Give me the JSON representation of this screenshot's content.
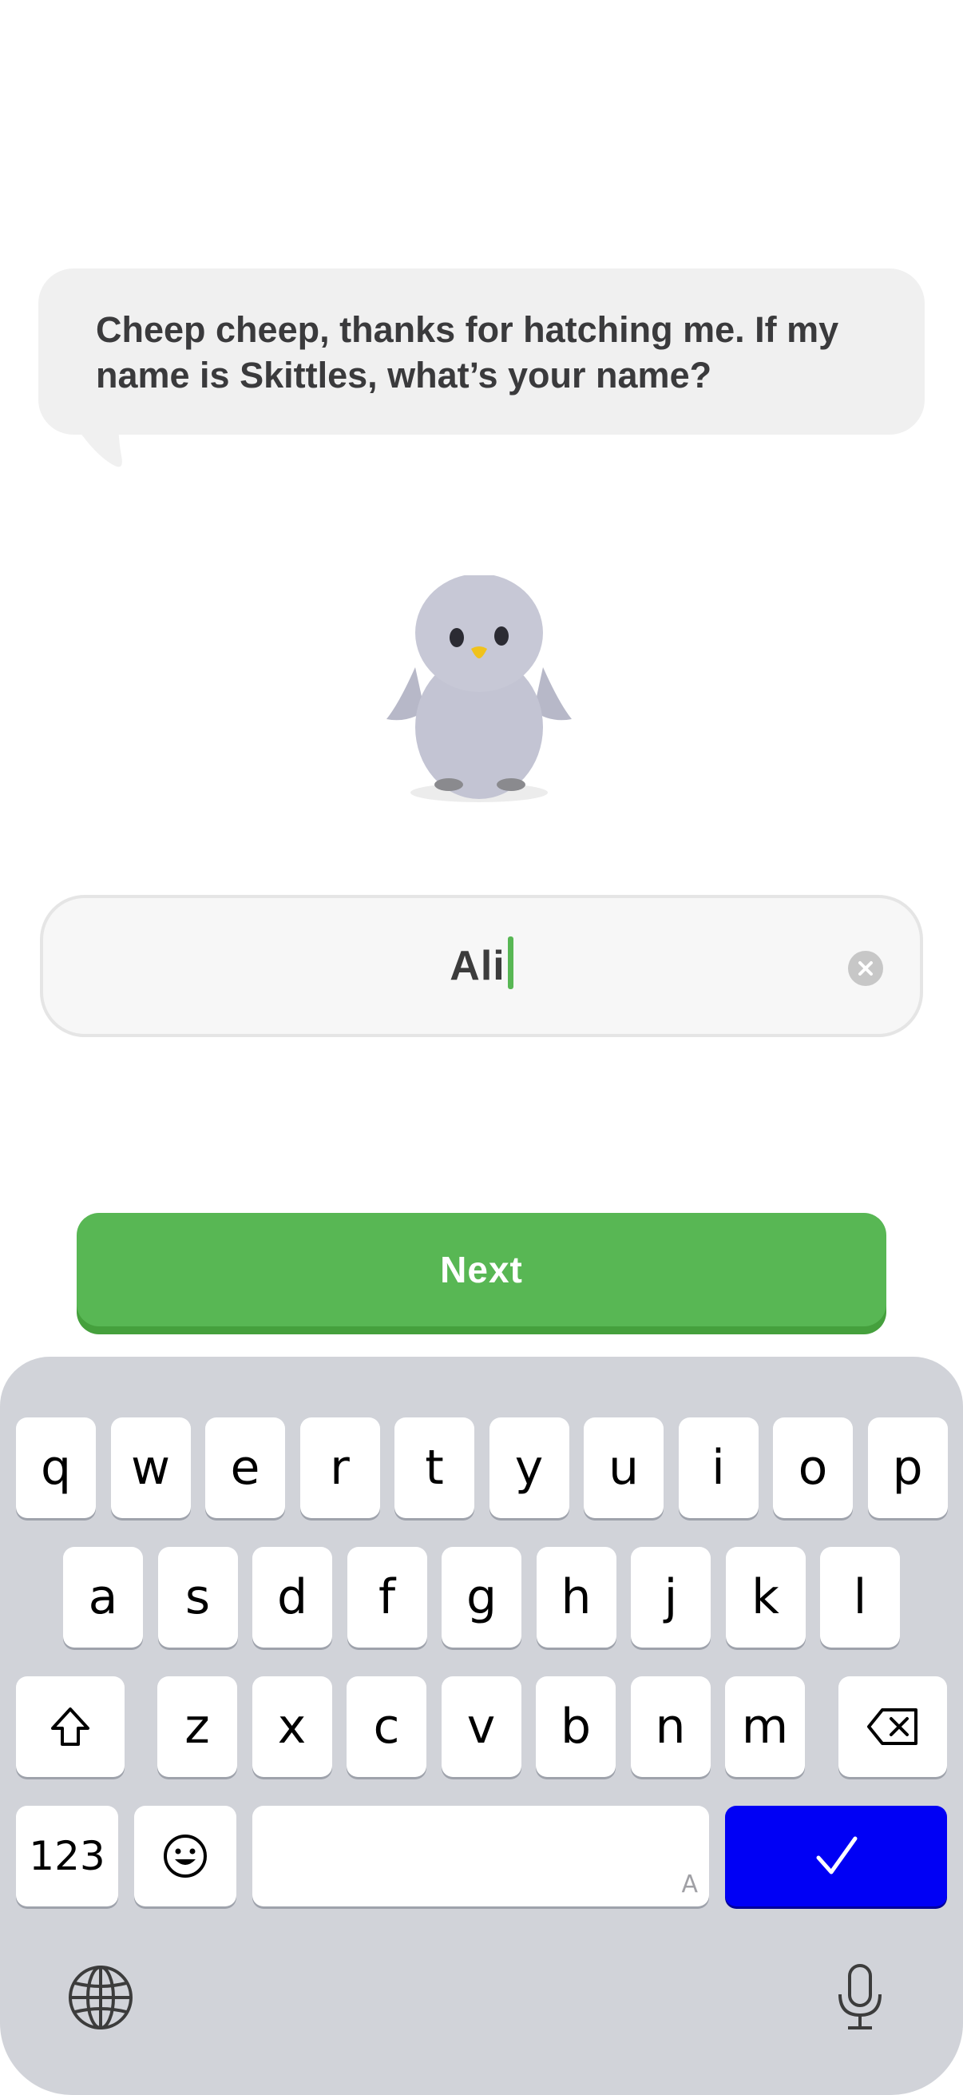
{
  "prompt": {
    "text": "Cheep cheep, thanks for hatching me. If my name is Skittles, what’s your name?"
  },
  "name_input": {
    "value": "Ali"
  },
  "next_button": {
    "label": "Next"
  },
  "keyboard": {
    "row1": [
      "q",
      "w",
      "e",
      "r",
      "t",
      "y",
      "u",
      "i",
      "o",
      "p"
    ],
    "row2": [
      "a",
      "s",
      "d",
      "f",
      "g",
      "h",
      "j",
      "k",
      "l"
    ],
    "row3": [
      "z",
      "x",
      "c",
      "v",
      "b",
      "n",
      "m"
    ],
    "numbers_label": "123",
    "space_hint": "A",
    "icons": {
      "shift": "shift-icon",
      "delete": "delete-icon",
      "emoji": "emoji-icon",
      "done": "checkmark-icon",
      "globe": "globe-icon",
      "mic": "microphone-icon"
    }
  },
  "colors": {
    "accent_green": "#58b754",
    "done_key_blue": "#0000f5",
    "keyboard_bg": "#d1d3d9"
  }
}
